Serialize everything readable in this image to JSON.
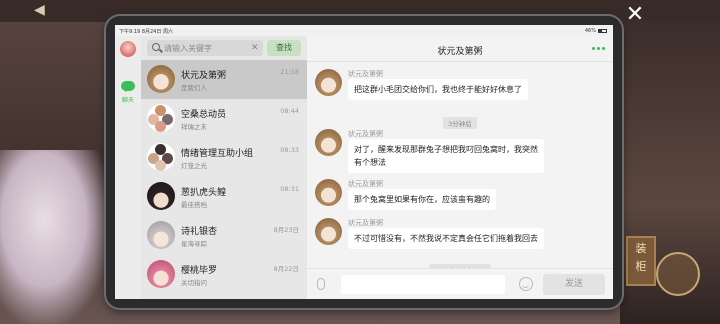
{
  "status_bar": {
    "left": "下午9:19  8月24日 周六",
    "battery": "46%"
  },
  "rail": {
    "chat_label": "聊天"
  },
  "search": {
    "placeholder": "请输入关键字",
    "button": "查找"
  },
  "contacts": [
    {
      "name": "状元及第粥",
      "sub": "是我们人",
      "time": "21:18"
    },
    {
      "name": "空桑总动员",
      "sub": "祥瑞之末",
      "time": "08:44"
    },
    {
      "name": "情绪管理互助小组",
      "sub": "灯笼之光",
      "time": "08:33"
    },
    {
      "name": "葱扒虎头鳇",
      "sub": "最佳搭档",
      "time": "08:31"
    },
    {
      "name": "诗礼银杏",
      "sub": "星海寻踪",
      "time": "8月23日"
    },
    {
      "name": "樱桃毕罗",
      "sub": "关切指问",
      "time": "8月22日"
    }
  ],
  "chat": {
    "title": "状元及第粥",
    "messages": [
      {
        "sender": "状元及第粥",
        "lines": [
          "把这群小毛团交给你们，我也终于能好好休息了"
        ]
      },
      {
        "sender": "状元及第粥",
        "lines": [
          "对了，醒来发现那群兔子想把我叼回兔窝时，我突然",
          "有个想法"
        ]
      },
      {
        "sender": "状元及第粥",
        "lines": [
          "那个兔窝里如果有你在，应该蛮有趣的"
        ]
      },
      {
        "sender": "状元及第粥",
        "lines": [
          "不过可惜没有，不然我说不定真会任它们拖着我回去"
        ]
      }
    ],
    "time_divider": "3分钟后",
    "end_divider": "——话题结束——",
    "send_label": "发送"
  }
}
